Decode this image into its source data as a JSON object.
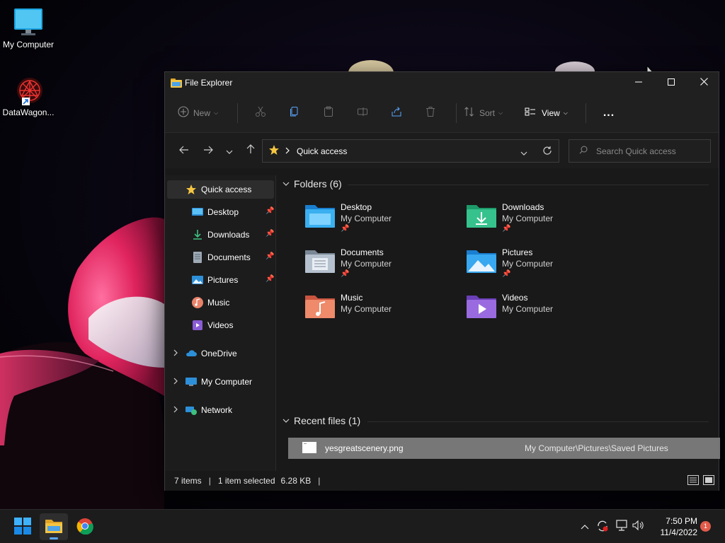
{
  "desktop": {
    "icons": [
      {
        "label": "My Computer",
        "icon": "monitor-icon"
      },
      {
        "label": "DataWagon...",
        "icon": "shortcut-icon"
      }
    ]
  },
  "window": {
    "title": "File Explorer",
    "controls": {
      "minimize": "minimize-icon",
      "maximize": "maximize-icon",
      "close": "close-icon"
    }
  },
  "toolbar": {
    "new_label": "New",
    "sort_label": "Sort",
    "view_label": "View",
    "more_label": "..."
  },
  "navigation": {
    "current": "Quick access",
    "search_placeholder": "Search Quick access"
  },
  "sidebar": {
    "quick_access": "Quick access",
    "items": [
      {
        "label": "Desktop",
        "pinned": true
      },
      {
        "label": "Downloads",
        "pinned": true
      },
      {
        "label": "Documents",
        "pinned": true
      },
      {
        "label": "Pictures",
        "pinned": true
      },
      {
        "label": "Music",
        "pinned": false
      },
      {
        "label": "Videos",
        "pinned": false
      }
    ],
    "onedrive": "OneDrive",
    "my_computer": "My Computer",
    "network": "Network"
  },
  "main": {
    "folders_header": "Folders (6)",
    "folders": [
      {
        "name": "Desktop",
        "location": "My Computer",
        "pinned": true
      },
      {
        "name": "Downloads",
        "location": "My Computer",
        "pinned": true
      },
      {
        "name": "Documents",
        "location": "My Computer",
        "pinned": true
      },
      {
        "name": "Pictures",
        "location": "My Computer",
        "pinned": true
      },
      {
        "name": "Music",
        "location": "My Computer",
        "pinned": false
      },
      {
        "name": "Videos",
        "location": "My Computer",
        "pinned": false
      }
    ],
    "recent_header": "Recent files (1)",
    "recent": [
      {
        "name": "yesgreatscenery.png",
        "path": "My Computer\\Pictures\\Saved Pictures"
      }
    ]
  },
  "status": {
    "items": "7 items",
    "selected": "1 item selected",
    "size": "6.28 KB"
  },
  "taskbar": {
    "time": "7:50 PM",
    "date": "11/4/2022",
    "notifications": "1"
  },
  "colors": {
    "accent": "#0078d4",
    "selection_row": "#777777",
    "notification_badge": "#e15b4a"
  }
}
